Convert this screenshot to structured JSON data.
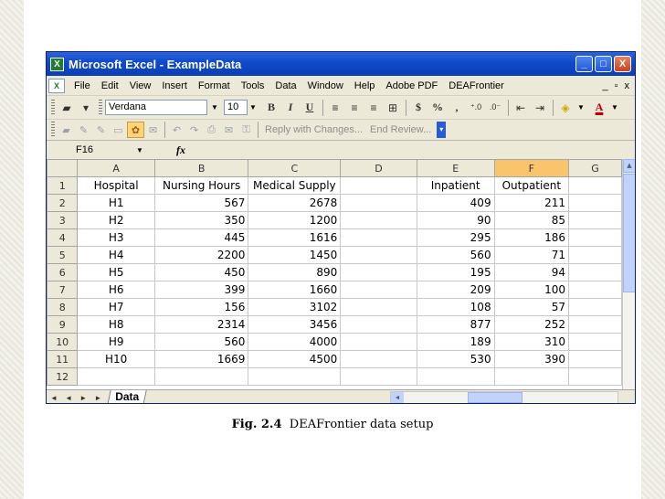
{
  "window": {
    "title": "Microsoft Excel - ExampleData",
    "buttons": [
      "_",
      "□",
      "X"
    ],
    "doc_buttons": [
      "_",
      "ð",
      "x"
    ]
  },
  "menu": {
    "items": [
      "File",
      "Edit",
      "View",
      "Insert",
      "Format",
      "Tools",
      "Data",
      "Window",
      "Help",
      "Adobe PDF",
      "DEAFrontier"
    ]
  },
  "toolbar": {
    "font": "Verdana",
    "size": "10",
    "bold": "B",
    "italic": "I",
    "underline": "U",
    "currency": "$",
    "percent": "%",
    "comma": ","
  },
  "review_toolbar": {
    "reply_text": "Reply with Changes...",
    "end_review": "End Review..."
  },
  "formula_bar": {
    "name_box": "F16",
    "fx": "fx"
  },
  "sheet": {
    "columns": [
      "",
      "A",
      "B",
      "C",
      "D",
      "E",
      "F",
      "G"
    ],
    "selected_column": "F",
    "rows": [
      [
        "1",
        "Hospital",
        "Nursing Hours",
        "Medical Supply",
        "",
        "Inpatient",
        "Outpatient",
        ""
      ],
      [
        "2",
        "H1",
        "567",
        "2678",
        "",
        "409",
        "211",
        ""
      ],
      [
        "3",
        "H2",
        "350",
        "1200",
        "",
        "90",
        "85",
        ""
      ],
      [
        "4",
        "H3",
        "445",
        "1616",
        "",
        "295",
        "186",
        ""
      ],
      [
        "5",
        "H4",
        "2200",
        "1450",
        "",
        "560",
        "71",
        ""
      ],
      [
        "6",
        "H5",
        "450",
        "890",
        "",
        "195",
        "94",
        ""
      ],
      [
        "7",
        "H6",
        "399",
        "1660",
        "",
        "209",
        "100",
        ""
      ],
      [
        "8",
        "H7",
        "156",
        "3102",
        "",
        "108",
        "57",
        ""
      ],
      [
        "9",
        "H8",
        "2314",
        "3456",
        "",
        "877",
        "252",
        ""
      ],
      [
        "10",
        "H9",
        "560",
        "4000",
        "",
        "189",
        "310",
        ""
      ],
      [
        "11",
        "H10",
        "1669",
        "4500",
        "",
        "530",
        "390",
        ""
      ],
      [
        "12",
        "",
        "",
        "",
        "",
        "",
        "",
        ""
      ]
    ]
  },
  "sheet_tabs": {
    "nav": "◄ ◄ ► ►",
    "active": "Data"
  },
  "caption": {
    "label": "Fig. 2.4",
    "text": "DEAFrontier data setup"
  }
}
